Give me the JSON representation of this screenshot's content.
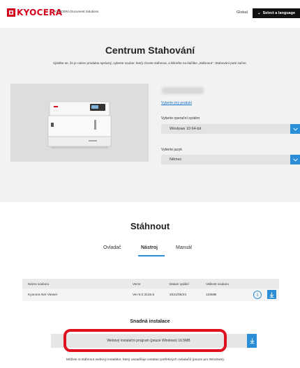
{
  "header": {
    "brand": "KYOCERA",
    "brand_sub": "KYOCERA Document Solutions",
    "global_label": "Global",
    "language_button": "Select a language",
    "brand_color": "#d6001c"
  },
  "hero": {
    "title": "Centrum Stahování",
    "subtitle": "Ujistěte se, že je název produktu správný, vyberte soubor, který chcete stáhnout, a klikněte na tlačítko „Stáhnout\". Stahování poté začne.",
    "other_product_link": "Vyberte jiný produkt",
    "os_label": "Vyberte operační systém",
    "os_value": "Windows 10 64-bit",
    "language_label": "Vyberte jazyk",
    "language_value": "Němec"
  },
  "download": {
    "title": "Stáhnout",
    "tabs": [
      {
        "label": "Ovladač",
        "active": false
      },
      {
        "label": "Nástroj",
        "active": true
      },
      {
        "label": "Manuál",
        "active": false
      }
    ],
    "table": {
      "headers": [
        "Název souboru",
        "Verze",
        "Datum vydání",
        "Velikost souboru"
      ],
      "rows": [
        {
          "name": "Kyocera Net Viewer",
          "version": "Ver 6.0.3126.6",
          "date": "2021/06/23",
          "size": "126MB"
        }
      ]
    }
  },
  "easy_install": {
    "title": "Snadná instalace",
    "item_label": "Webový instalační program (pouze Windows)   16.5MB",
    "description": "Můžete si stáhnout webový instalátor, který usnadňuje instalaci potřebných ovladačů (pouze pro Windows)."
  },
  "colors": {
    "accent": "#2a8fd6",
    "highlight": "#e0111f"
  }
}
